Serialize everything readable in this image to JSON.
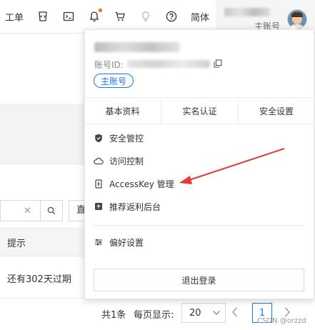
{
  "topbar": {
    "ticket_label": "工单",
    "lang_label": "简体",
    "account_type": "主账号",
    "icons": [
      "ticket-icon",
      "code-icon",
      "terminal-icon",
      "bell-icon",
      "cart-icon",
      "lightbulb-icon",
      "help-icon",
      "avatar"
    ]
  },
  "panel": {
    "account_id_label": "账号ID:",
    "main_tag": "主账号",
    "tabs": [
      "基本资料",
      "实名认证",
      "安全设置"
    ],
    "menu": [
      {
        "label": "安全管控",
        "icon": "shield-icon"
      },
      {
        "label": "访问控制",
        "icon": "cloud-icon"
      },
      {
        "label": "AccessKey 管理",
        "icon": "key-icon"
      },
      {
        "label": "推荐返利后台",
        "icon": "gift-icon"
      }
    ],
    "preferences_label": "偏好设置",
    "logout_label": "退出登录"
  },
  "background": {
    "side_button_label": "直",
    "table_header": "提示",
    "table_row": "还有302天过期"
  },
  "pagination": {
    "total": "共1条",
    "page_size_label": "每页显示:",
    "page_size": "20",
    "current_page": "1"
  },
  "watermark": "CSDN @orzzd",
  "colors": {
    "accent": "#1677ff",
    "notify_dot": "#ff6a00",
    "annotation_arrow": "#e53935"
  }
}
